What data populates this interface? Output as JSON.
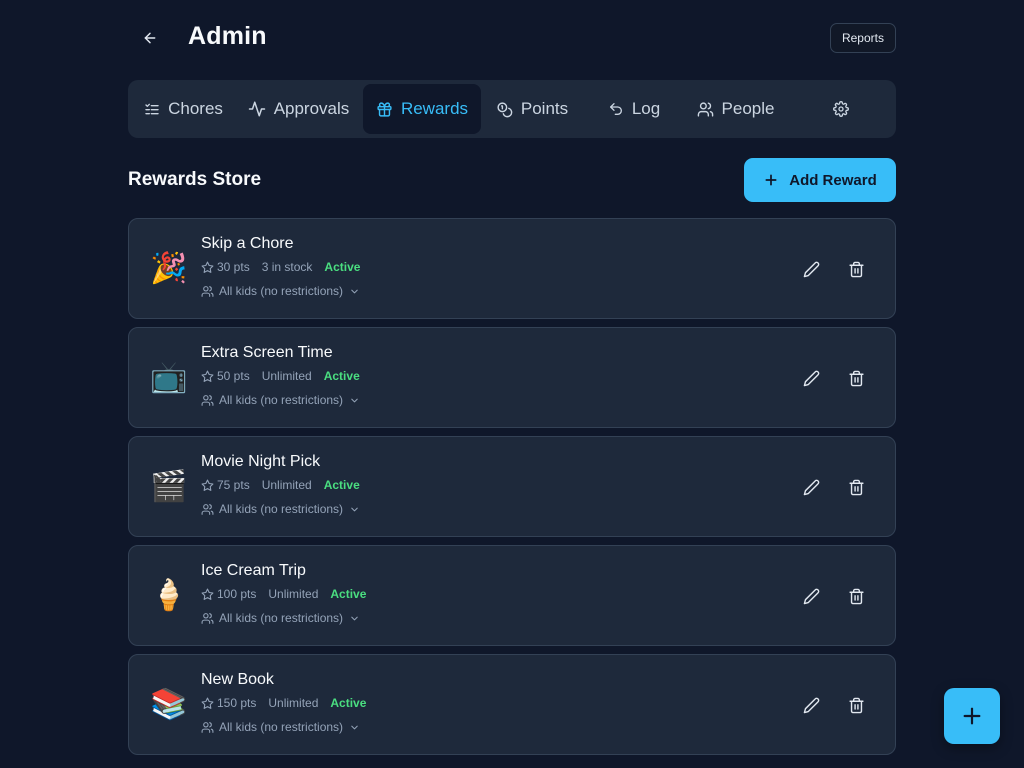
{
  "header": {
    "title": "Admin",
    "reports_label": "Reports"
  },
  "tabs": [
    {
      "label": "Chores",
      "icon": "list-check-icon",
      "active": false
    },
    {
      "label": "Approvals",
      "icon": "activity-icon",
      "active": false
    },
    {
      "label": "Rewards",
      "icon": "gift-icon",
      "active": true
    },
    {
      "label": "Points",
      "icon": "coins-icon",
      "active": false
    },
    {
      "label": "Log",
      "icon": "undo-icon",
      "active": false
    },
    {
      "label": "People",
      "icon": "users-icon",
      "active": false
    },
    {
      "label": "",
      "icon": "gear-icon",
      "active": false
    }
  ],
  "rewards": {
    "section_title": "Rewards Store",
    "add_label": "Add Reward",
    "items": [
      {
        "emoji": "🎉",
        "name": "Skip a Chore",
        "points": "30 pts",
        "stock": "3 in stock",
        "status": "Active",
        "restriction": "All kids (no restrictions)"
      },
      {
        "emoji": "📺",
        "name": "Extra Screen Time",
        "points": "50 pts",
        "stock": "Unlimited",
        "status": "Active",
        "restriction": "All kids (no restrictions)"
      },
      {
        "emoji": "🎬",
        "name": "Movie Night Pick",
        "points": "75 pts",
        "stock": "Unlimited",
        "status": "Active",
        "restriction": "All kids (no restrictions)"
      },
      {
        "emoji": "🍦",
        "name": "Ice Cream Trip",
        "points": "100 pts",
        "stock": "Unlimited",
        "status": "Active",
        "restriction": "All kids (no restrictions)"
      },
      {
        "emoji": "📚",
        "name": "New Book",
        "points": "150 pts",
        "stock": "Unlimited",
        "status": "Active",
        "restriction": "All kids (no restrictions)"
      }
    ]
  },
  "colors": {
    "background": "#0f172a",
    "surface": "#1e293b",
    "accent": "#38bdf8",
    "active_status": "#4ade80"
  }
}
